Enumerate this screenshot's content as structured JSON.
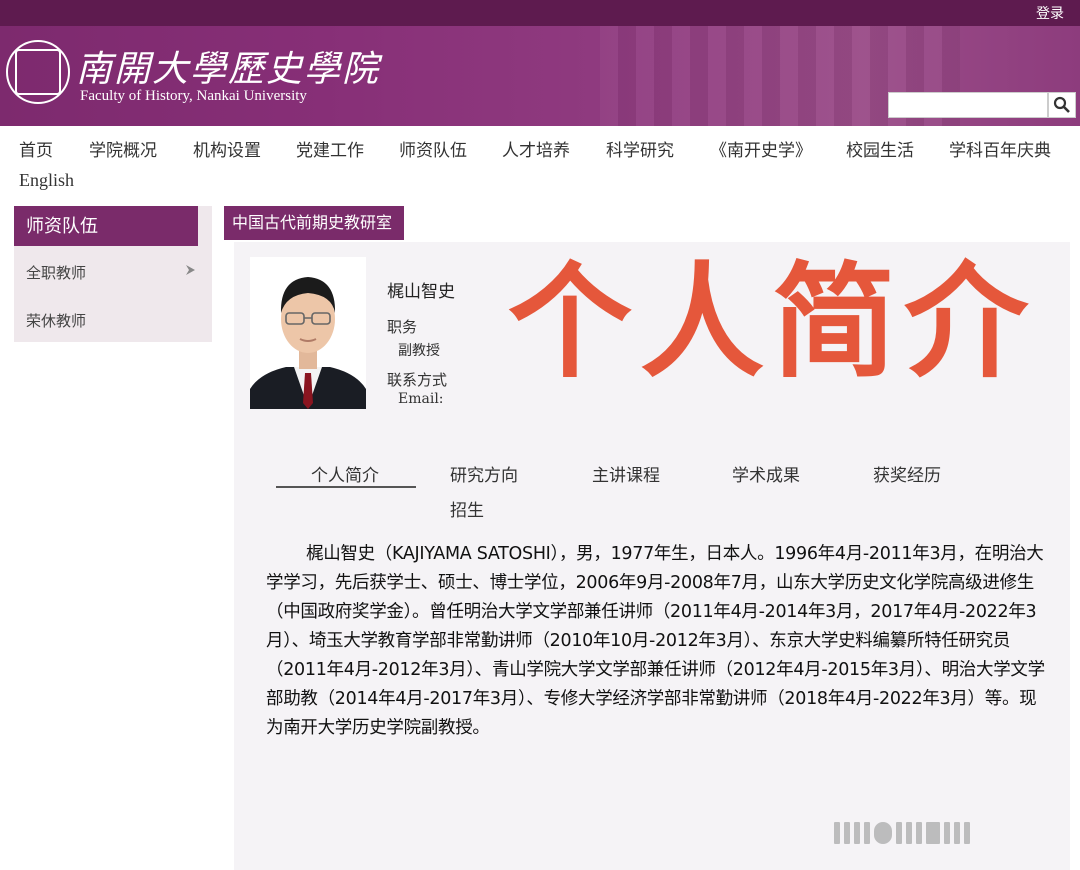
{
  "header": {
    "login": "登录",
    "logo_title": "南開大學歷史學院",
    "logo_subtitle": "Faculty of History, Nankai University",
    "search_placeholder": ""
  },
  "nav": {
    "items": [
      "首页",
      "学院概况",
      "机构设置",
      "党建工作",
      "师资队伍",
      "人才培养",
      "科学研究",
      "《南开史学》",
      "校园生活",
      "学科百年庆典"
    ],
    "english": "English"
  },
  "sidebar": {
    "title": "师资队伍",
    "items": [
      "全职教师",
      "荣休教师"
    ]
  },
  "main": {
    "section_tag": "中国古代前期史教研室",
    "profile": {
      "name": "梶山智史",
      "position_label": "职务",
      "position_value": "副教授",
      "contact_label": "联系方式",
      "email_label": "Email:"
    },
    "overlay_title": "个人简介",
    "tabs": [
      "个人简介",
      "研究方向",
      "主讲课程",
      "学术成果",
      "获奖经历",
      "招生"
    ],
    "bio": "梶山智史（KAJIYAMA SATOSHI），男，1977年生，日本人。1996年4月-2011年3月，在明治大学学习，先后获学士、硕士、博士学位，2006年9月-2008年7月，山东大学历史文化学院高级进修生（中国政府奖学金）。曾任明治大学文学部兼任讲师（2011年4月-2014年3月，2017年4月-2022年3月）、埼玉大学教育学部非常勤讲师（2010年10月-2012年3月）、东京大学史料编纂所特任研究员（2011年4月-2012年3月）、青山学院大学文学部兼任讲师（2012年4月-2015年3月）、明治大学文学部助教（2014年4月-2017年3月）、专修大学经济学部非常勤讲师（2018年4月-2022年3月）等。现为南开大学历史学院副教授。"
  },
  "colors": {
    "brand": "#7a2b6a",
    "overlay": "#e5573b"
  }
}
